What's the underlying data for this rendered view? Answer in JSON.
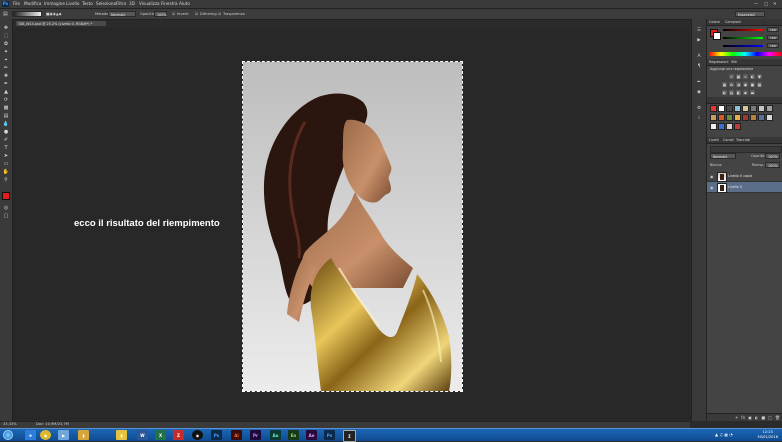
{
  "menubar": {
    "app_icon": "Ps",
    "items": [
      "File",
      "Modifica",
      "Immagine",
      "Livello",
      "Testo",
      "Seleziona",
      "Filtro",
      "3D",
      "Visualizza",
      "Finestra",
      "Aiuto"
    ]
  },
  "options": {
    "mode_label": "Metodo:",
    "mode_value": "Normale",
    "opacity_label": "Opacità:",
    "opacity_value": "100%",
    "invert_label": "Inverti",
    "dither_label": "Dithering",
    "transparency_label": "Trasparenza",
    "workspace_value": "Essenziali"
  },
  "document": {
    "tab_title": "TAB_W14.psd @ 25,2% (Livello 0, RGB/8*) *"
  },
  "caption": "ecco il risultato del riempimento",
  "status": {
    "zoom": "33,33%",
    "doc_size": "Doc: 10,9M/23,7M"
  },
  "panels": {
    "color_tabs": [
      "Colore",
      "Campioni"
    ],
    "color_values": [
      "168",
      "168",
      "168"
    ],
    "adjustments_tabs": [
      "Regolazioni",
      "Stili"
    ],
    "adjustments_title": "Aggiungi una regolazione",
    "layers_tabs": [
      "Livelli",
      "Canali",
      "Tracciati"
    ],
    "blend_mode": "Normale",
    "opacity_label": "Opacità:",
    "opacity_value": "100%",
    "fill_label": "Riemp.:",
    "fill_value": "100%",
    "lock_label": "Blocca:",
    "layers": [
      "Livello 0 copia",
      "Livello 0"
    ]
  },
  "taskbar": {
    "time": "12:23",
    "date": "30/01/2016",
    "apps": [
      "IE",
      "Chrome",
      "Files",
      "Media",
      "Folder",
      "Word",
      "Excel",
      "FileZilla",
      "OBS",
      "Photoshop",
      "Acrobat",
      "Premiere",
      "Audition",
      "Encore",
      "Excel2",
      "Pr",
      "Ae",
      "Sigma"
    ]
  },
  "colors": {
    "accent": "#1c67b7",
    "foreground": "#e51c1c",
    "background": "#ffffff"
  }
}
